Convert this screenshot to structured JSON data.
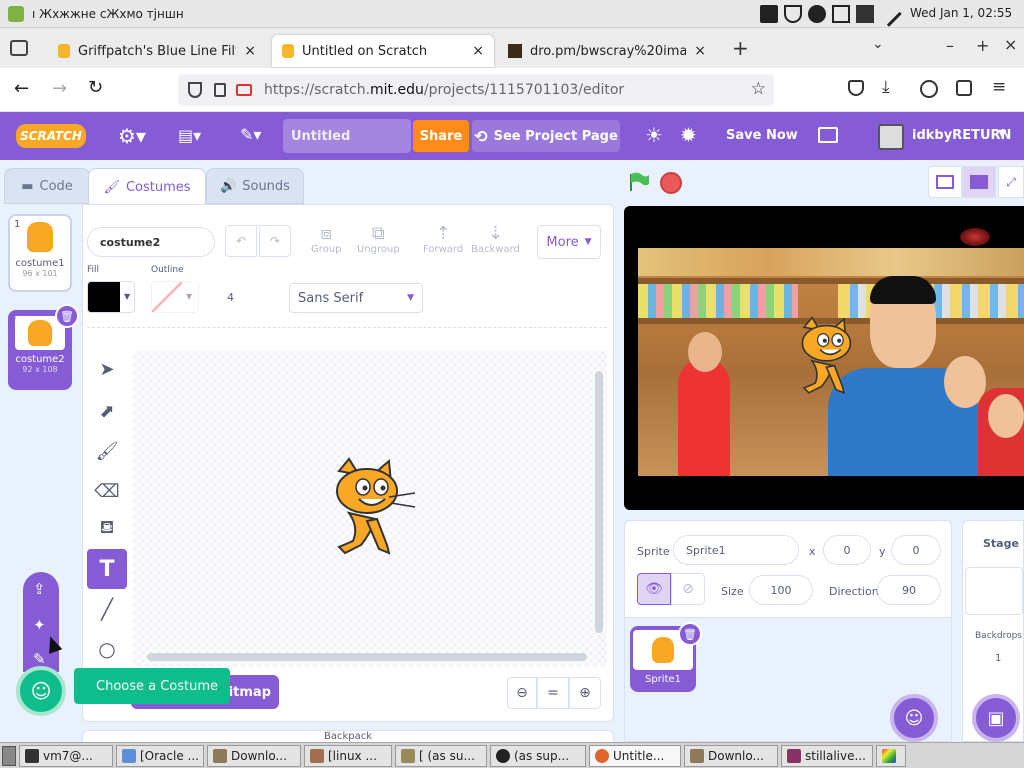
{
  "system": {
    "menu_text": "ı Жхжжне сЖхмо тјншн",
    "clock": "Wed Jan 1, 02:55"
  },
  "browser": {
    "tabs": [
      {
        "label": "Griffpatch's Blue Line Filter"
      },
      {
        "label": "Untitled on Scratch"
      },
      {
        "label": "dro.pm/bwscray%20image"
      }
    ],
    "new_tab": "+",
    "url_prefix": "https://scratch.",
    "url_domain": "mit.edu",
    "url_path": "/projects/1115701103/editor"
  },
  "scratch_menu": {
    "logo": "SCRATCH",
    "project_title": "Untitled",
    "share": "Share",
    "see_project_page": "See Project Page",
    "save_now": "Save Now",
    "username": "idkbyRETURN"
  },
  "editor_tabs": {
    "code": "Code",
    "costumes": "Costumes",
    "sounds": "Sounds"
  },
  "costumes": [
    {
      "index": "1",
      "name": "costume1",
      "size": "96 x 101"
    },
    {
      "index": "2",
      "name": "costume2",
      "size": "92 x 108"
    }
  ],
  "paint": {
    "costume_name": "costume2",
    "group": "Group",
    "ungroup": "Ungroup",
    "forward": "Forward",
    "backward": "Backward",
    "more": "More",
    "fill_label": "Fill",
    "outline_label": "Outline",
    "outline_width": "4",
    "font": "Sans Serif",
    "convert_bitmap": "Bitmap",
    "zoom_reset": "="
  },
  "choose_costume_tooltip": "Choose a Costume",
  "sprite_info": {
    "sprite_label": "Sprite",
    "sprite_name": "Sprite1",
    "x_label": "x",
    "x_value": "0",
    "y_label": "y",
    "y_value": "0",
    "size_label": "Size",
    "size_value": "100",
    "direction_label": "Direction",
    "direction_value": "90"
  },
  "sprite_list": [
    {
      "name": "Sprite1"
    }
  ],
  "stage_panel": {
    "title": "Stage",
    "backdrops_label": "Backdrops",
    "backdrops_count": "1"
  },
  "backpack_label": "Backpack",
  "taskbar": [
    {
      "label": "vm7@...",
      "color": "#333333"
    },
    {
      "label": "[Oracle ...",
      "color": "#5b8fd9"
    },
    {
      "label": "Downlo...",
      "color": "#8c7a5a"
    },
    {
      "label": "[linux ...",
      "color": "#a07050"
    },
    {
      "label": "[ (as su...",
      "color": "#9a8a5a"
    },
    {
      "label": "(as sup...",
      "color": "#222222"
    },
    {
      "label": "Untitle...",
      "color": "#e2662b"
    },
    {
      "label": "Downlo...",
      "color": "#8c7a5a"
    },
    {
      "label": "stillalive...",
      "color": "#883366"
    }
  ],
  "colors": {
    "scratch_purple": "#855cd6",
    "share_orange": "#ff8c1a",
    "green_flag": "#4cbf56",
    "stop_red": "#ec5959",
    "teal": "#0fbd8c"
  }
}
